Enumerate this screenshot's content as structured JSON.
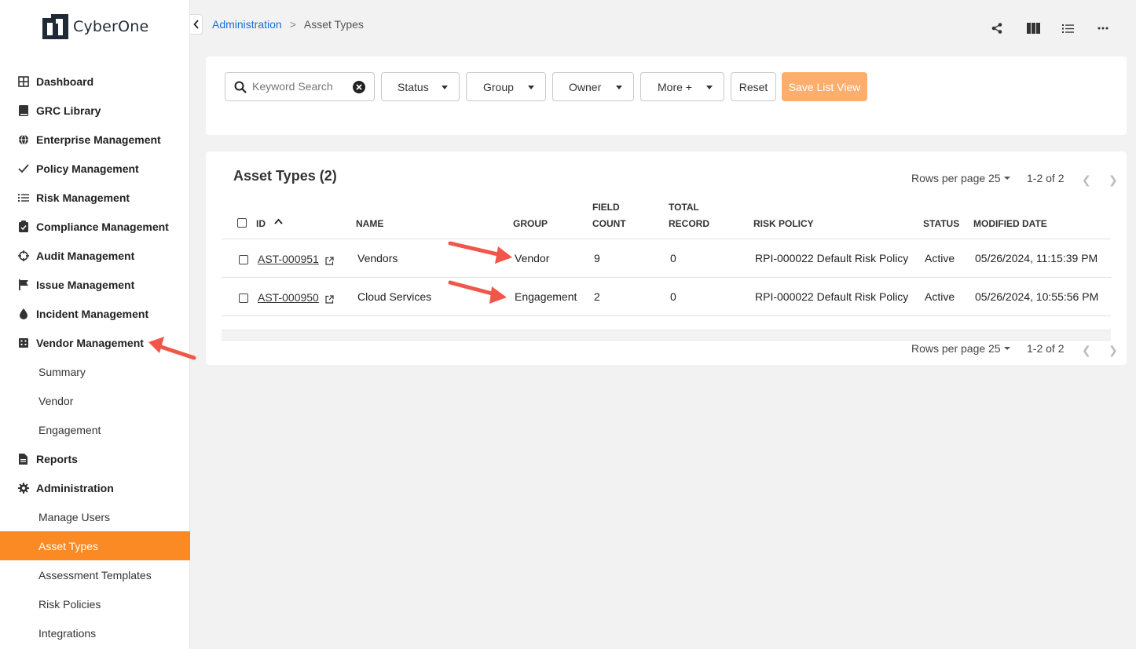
{
  "app": {
    "logo_text": "CyberOne"
  },
  "sidebar": {
    "items": [
      {
        "label": "Dashboard",
        "icon": "dashboard-icon",
        "sub": false,
        "active": false
      },
      {
        "label": "GRC Library",
        "icon": "book-icon",
        "sub": false,
        "active": false
      },
      {
        "label": "Enterprise Management",
        "icon": "globe-icon",
        "sub": false,
        "active": false
      },
      {
        "label": "Policy Management",
        "icon": "check-icon",
        "sub": false,
        "active": false
      },
      {
        "label": "Risk Management",
        "icon": "list-icon",
        "sub": false,
        "active": false
      },
      {
        "label": "Compliance Management",
        "icon": "clipboard-check-icon",
        "sub": false,
        "active": false
      },
      {
        "label": "Audit Management",
        "icon": "crosshair-icon",
        "sub": false,
        "active": false
      },
      {
        "label": "Issue Management",
        "icon": "flag-icon",
        "sub": false,
        "active": false
      },
      {
        "label": "Incident Management",
        "icon": "drop-icon",
        "sub": false,
        "active": false
      },
      {
        "label": "Vendor Management",
        "icon": "building-icon",
        "sub": false,
        "active": false
      },
      {
        "label": "Summary",
        "sub": true,
        "active": false
      },
      {
        "label": "Vendor",
        "sub": true,
        "active": false
      },
      {
        "label": "Engagement",
        "sub": true,
        "active": false
      },
      {
        "label": "Reports",
        "icon": "file-icon",
        "sub": false,
        "active": false
      },
      {
        "label": "Administration",
        "icon": "gear-icon",
        "sub": false,
        "active": false
      },
      {
        "label": "Manage Users",
        "sub": true,
        "active": false
      },
      {
        "label": "Asset Types",
        "sub": true,
        "active": true
      },
      {
        "label": "Assessment Templates",
        "sub": true,
        "active": false
      },
      {
        "label": "Risk Policies",
        "sub": true,
        "active": false
      },
      {
        "label": "Integrations",
        "sub": true,
        "active": false
      }
    ]
  },
  "breadcrumb": {
    "parent": "Administration",
    "separator": ">",
    "current": "Asset Types"
  },
  "toolbar_icons": [
    "share-icon",
    "columns-icon",
    "list-view-icon",
    "more-icon"
  ],
  "filters": {
    "search_placeholder": "Keyword Search",
    "status": "Status",
    "group": "Group",
    "owner": "Owner",
    "more": "More +",
    "reset": "Reset",
    "save": "Save List View"
  },
  "table": {
    "title": "Asset Types (2)",
    "rows_per_page_label": "Rows per page",
    "rows_per_page_value": "25",
    "range": "1-2 of 2",
    "headers": {
      "id": "ID",
      "name": "NAME",
      "group": "GROUP",
      "field_count_1": "FIELD",
      "field_count_2": "COUNT",
      "total_record_1": "TOTAL",
      "total_record_2": "RECORD",
      "risk_policy": "RISK POLICY",
      "status": "STATUS",
      "modified": "MODIFIED DATE"
    },
    "rows": [
      {
        "id": "AST-000951",
        "name": "Vendors",
        "group": "Vendor",
        "field_count": "9",
        "total_record": "0",
        "risk_policy": "RPI-000022 Default Risk Policy",
        "status": "Active",
        "modified": "05/26/2024, 11:15:39 PM"
      },
      {
        "id": "AST-000950",
        "name": "Cloud Services",
        "group": "Engagement",
        "field_count": "2",
        "total_record": "0",
        "risk_policy": "RPI-000022 Default Risk Policy",
        "status": "Active",
        "modified": "05/26/2024, 10:55:56 PM"
      }
    ]
  },
  "colors": {
    "accent": "#fb8a24",
    "save_button": "#fdae6c",
    "link": "#1a6fd6",
    "arrow": "#f0574a"
  }
}
